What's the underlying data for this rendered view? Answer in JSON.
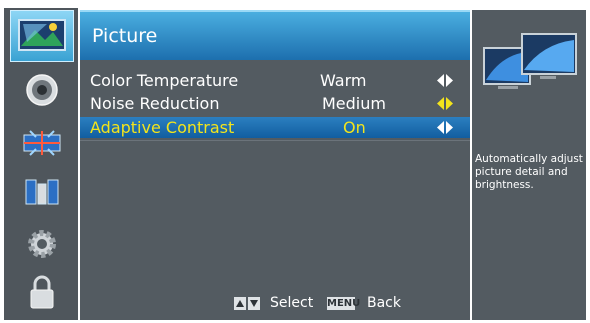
{
  "header": {
    "title": "Picture"
  },
  "menu": {
    "items": [
      {
        "label": "Color Temperature",
        "value": "Warm",
        "arrow_color": "#ffffff",
        "highlighted": false
      },
      {
        "label": "Noise Reduction",
        "value": "Medium",
        "arrow_color": "#f3e41c",
        "highlighted": false
      },
      {
        "label": "Adaptive Contrast",
        "value": "On",
        "arrow_color": "#ffffff",
        "highlighted": true
      }
    ]
  },
  "footer": {
    "select_label": "Select",
    "menu_key": "MENU",
    "back_label": "Back"
  },
  "help": {
    "text": "Automatically adjust picture detail and brightness."
  },
  "sidebar": {
    "icons": [
      "picture-icon",
      "audio-icon",
      "channel-icon",
      "setup-icon",
      "settings-icon",
      "lock-icon"
    ],
    "selected_index": 0
  },
  "colors": {
    "highlight_text": "#f3e41c",
    "header_blue": "#1d6fae",
    "panel_gray": "#535b61"
  }
}
